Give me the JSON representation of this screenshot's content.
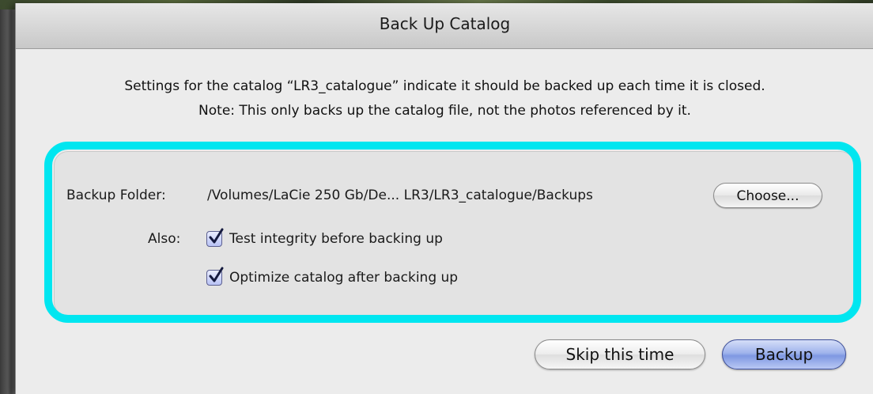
{
  "dialog": {
    "title": "Back Up Catalog",
    "message_line1": "Settings for the catalog “LR3_catalogue” indicate it should be backed up each time it is closed.",
    "message_line2": "Note: This only backs up the catalog file, not the photos referenced by it."
  },
  "settings": {
    "folder_label": "Backup Folder:",
    "folder_path": "/Volumes/LaCie 250 Gb/De... LR3/LR3_catalogue/Backups",
    "choose_label": "Choose...",
    "also_label": "Also:",
    "options": [
      {
        "label": "Test integrity before backing up",
        "checked": true
      },
      {
        "label": "Optimize catalog after backing up",
        "checked": true
      }
    ]
  },
  "buttons": {
    "skip_label": "Skip this time",
    "backup_label": "Backup"
  },
  "colors": {
    "highlight": "#00e6f0",
    "default_button": "#8fa6ea"
  }
}
